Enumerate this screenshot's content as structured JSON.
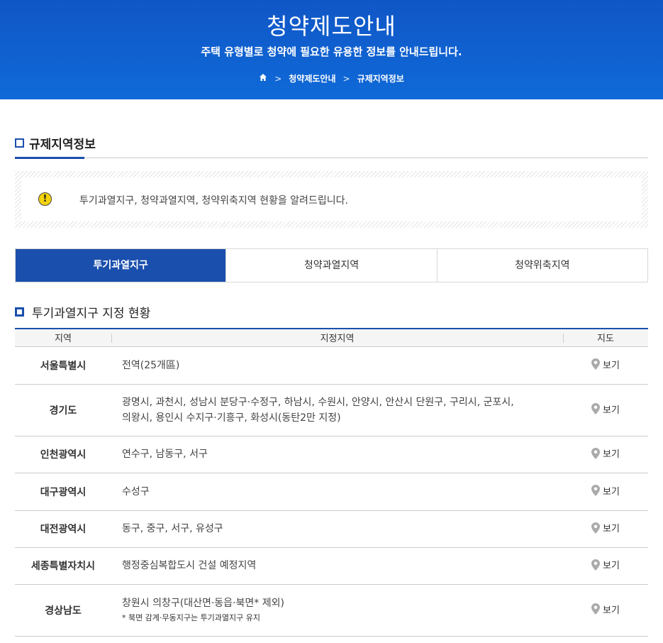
{
  "banner": {
    "title": "청약제도안내",
    "subtitle": "주택 유형별로 청약에 필요한 유용한 정보를 안내드립니다.",
    "breadcrumb": [
      "청약제도안내",
      "규제지역정보"
    ]
  },
  "section": {
    "title": "규제지역정보"
  },
  "notice": {
    "text": "투기과열지구, 청약과열지역, 청약위축지역 현황을 알려드립니다."
  },
  "tabs": [
    {
      "label": "투기과열지구",
      "active": true
    },
    {
      "label": "청약과열지역",
      "active": false
    },
    {
      "label": "청약위축지역",
      "active": false
    }
  ],
  "subsection": {
    "title": "투기과열지구 지정 현황"
  },
  "table": {
    "headers": [
      "지역",
      "지정지역",
      "지도"
    ],
    "rows": [
      {
        "region": "서울특별시",
        "areas": [
          "전역(25개區)"
        ],
        "note": "",
        "map": "보기"
      },
      {
        "region": "경기도",
        "areas": [
          "광명시, 과천시, 성남시 분당구·수정구, 하남시, 수원시, 안양시, 안산시 단원구, 구리시, 군포시,",
          "의왕시, 용인시 수지구·기흥구, 화성시(동탄2만 지정)"
        ],
        "note": "",
        "map": "보기"
      },
      {
        "region": "인천광역시",
        "areas": [
          "연수구, 남동구, 서구"
        ],
        "note": "",
        "map": "보기"
      },
      {
        "region": "대구광역시",
        "areas": [
          "수성구"
        ],
        "note": "",
        "map": "보기"
      },
      {
        "region": "대전광역시",
        "areas": [
          "동구, 중구, 서구, 유성구"
        ],
        "note": "",
        "map": "보기"
      },
      {
        "region": "세종특별자치시",
        "areas": [
          "행정중심복합도시 건설 예정지역"
        ],
        "note": "",
        "map": "보기"
      },
      {
        "region": "경상남도",
        "areas": [
          "창원시 의창구(대산면·동읍·북면* 제외)"
        ],
        "note": "* 북면 감계·무동지구는 투기과열지구 유지",
        "map": "보기"
      }
    ]
  },
  "colors": {
    "primary": "#1a4fad",
    "banner": "#0f5fd0",
    "warning": "#f4d20b"
  }
}
